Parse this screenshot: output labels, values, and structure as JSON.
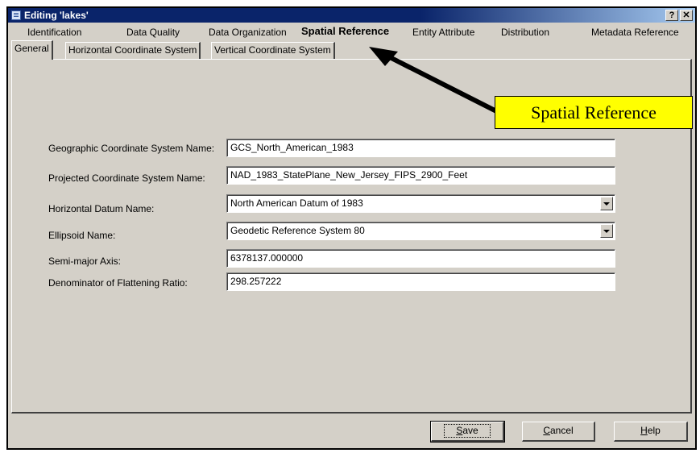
{
  "window": {
    "title": "Editing 'lakes'",
    "help_glyph": "?",
    "close_glyph": "✕"
  },
  "top_tabs": [
    {
      "label": "Identification"
    },
    {
      "label": "Data Quality"
    },
    {
      "label": "Data Organization"
    },
    {
      "label": "Spatial Reference",
      "active": true
    },
    {
      "label": "Entity Attribute"
    },
    {
      "label": "Distribution"
    },
    {
      "label": "Metadata Reference"
    }
  ],
  "sub_tabs": [
    {
      "label": "General",
      "active": true
    },
    {
      "label": "Horizontal Coordinate System"
    },
    {
      "label": "Vertical Coordinate System"
    }
  ],
  "fields": [
    {
      "label": "Geographic Coordinate System Name:",
      "value": "GCS_North_American_1983",
      "type": "text"
    },
    {
      "label": "Projected Coordinate System Name:",
      "value": "NAD_1983_StatePlane_New_Jersey_FIPS_2900_Feet",
      "type": "text"
    },
    {
      "label": "Horizontal Datum Name:",
      "value": "North American Datum of 1983",
      "type": "combo"
    },
    {
      "label": "Ellipsoid Name:",
      "value": "Geodetic Reference System 80",
      "type": "combo"
    },
    {
      "label": "Semi-major Axis:",
      "value": "6378137.000000",
      "type": "text"
    },
    {
      "label": "Denominator of Flattening Ratio:",
      "value": "298.257222",
      "type": "text"
    }
  ],
  "buttons": {
    "save": {
      "pre": "",
      "key": "S",
      "post": "ave"
    },
    "cancel": {
      "pre": "",
      "key": "C",
      "post": "ancel"
    },
    "help": {
      "pre": "",
      "key": "H",
      "post": "elp"
    }
  },
  "callout": {
    "text": "Spatial Reference"
  },
  "colors": {
    "titlebar": "#0a246a",
    "face": "#d4d0c8",
    "callout_bg": "#ffff00"
  }
}
